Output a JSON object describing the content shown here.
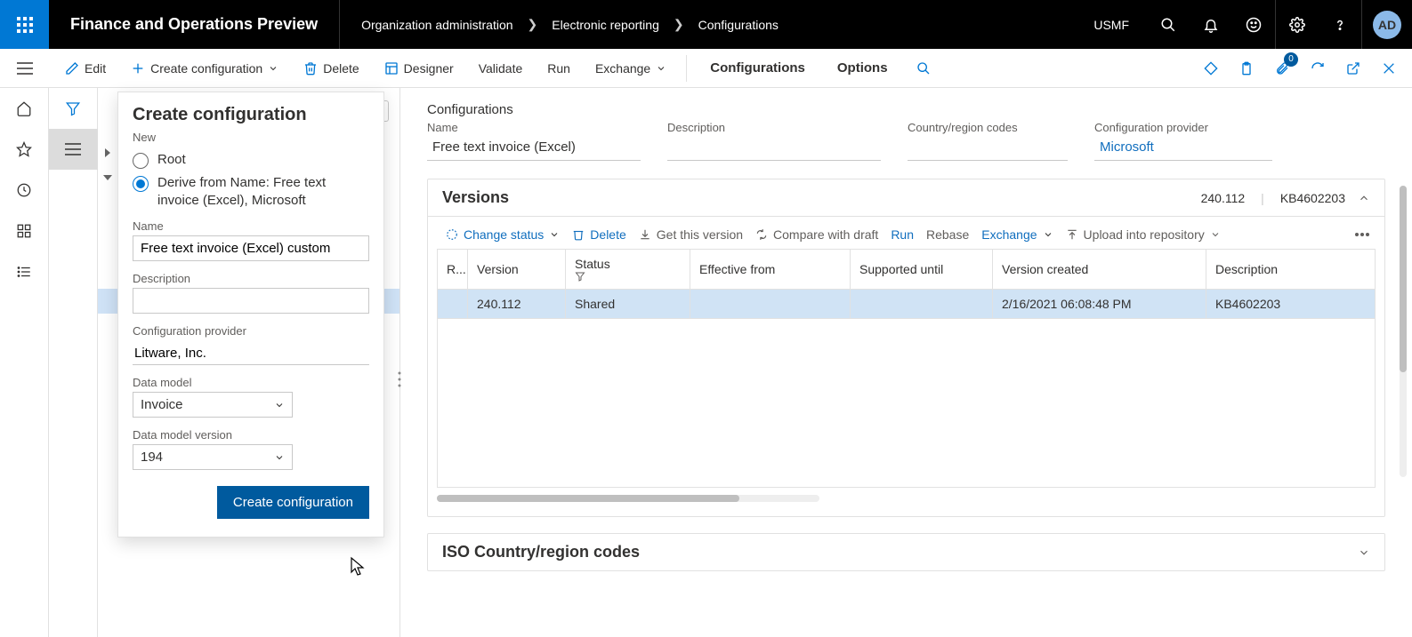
{
  "topbar": {
    "app_title": "Finance and Operations Preview",
    "breadcrumb": [
      "Organization administration",
      "Electronic reporting",
      "Configurations"
    ],
    "legal_entity": "USMF",
    "avatar": "AD"
  },
  "cmdbar": {
    "edit": "Edit",
    "create": "Create configuration",
    "delete": "Delete",
    "designer": "Designer",
    "validate": "Validate",
    "run": "Run",
    "exchange": "Exchange",
    "tabs": [
      "Configurations",
      "Options"
    ],
    "doc_count": "0"
  },
  "dropdown": {
    "title": "Create configuration",
    "group_new": "New",
    "radio_root": "Root",
    "radio_derive": "Derive from Name: Free text invoice (Excel), Microsoft",
    "name_label": "Name",
    "name_value": "Free text invoice (Excel) custom",
    "desc_label": "Description",
    "desc_value": "",
    "provider_label": "Configuration provider",
    "provider_value": "Litware, Inc.",
    "model_label": "Data model",
    "model_value": "Invoice",
    "model_ver_label": "Data model version",
    "model_ver_value": "194",
    "submit": "Create configuration"
  },
  "main": {
    "section": "Configurations",
    "name_label": "Name",
    "name_value": "Free text invoice (Excel)",
    "desc_label": "Description",
    "desc_value": "",
    "region_label": "Country/region codes",
    "region_value": "",
    "provider_label": "Configuration provider",
    "provider_value": "Microsoft"
  },
  "versions": {
    "title": "Versions",
    "head_version": "240.112",
    "head_kb": "KB4602203",
    "toolbar": {
      "change_status": "Change status",
      "delete": "Delete",
      "get": "Get this version",
      "compare": "Compare with draft",
      "run": "Run",
      "rebase": "Rebase",
      "exchange": "Exchange",
      "upload": "Upload into repository"
    },
    "columns": [
      "R...",
      "Version",
      "Status",
      "Effective from",
      "Supported until",
      "Version created",
      "Description"
    ],
    "rows": [
      {
        "r": "",
        "version": "240.112",
        "status": "Shared",
        "effective": "",
        "supported": "",
        "created": "2/16/2021 06:08:48 PM",
        "desc": "KB4602203"
      }
    ]
  },
  "iso": {
    "title": "ISO Country/region codes"
  }
}
